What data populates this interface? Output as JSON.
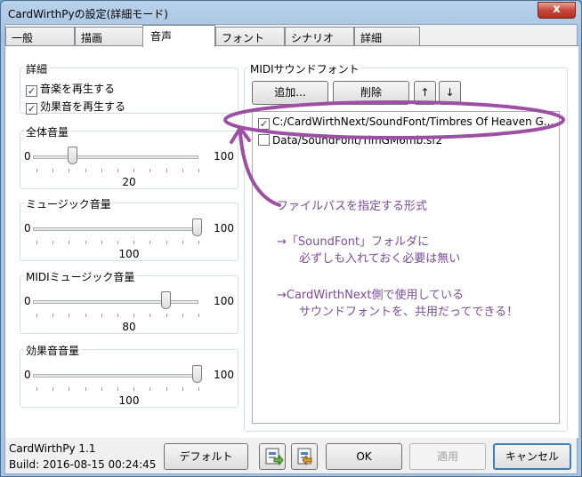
{
  "window": {
    "title": "CardWirthPyの設定(詳細モード)",
    "close_glyph": "x"
  },
  "tabs": [
    "一般",
    "描画",
    "音声",
    "フォント",
    "シナリオ",
    "詳細"
  ],
  "active_tab": "音声",
  "details": {
    "title": "詳細",
    "play_music": {
      "label": "音楽を再生する",
      "checked": true
    },
    "play_sfx": {
      "label": "効果音を再生する",
      "checked": true
    }
  },
  "volumes": [
    {
      "title": "全体音量",
      "min": "0",
      "max": "100",
      "value": 20
    },
    {
      "title": "ミュージック音量",
      "min": "0",
      "max": "100",
      "value": 100
    },
    {
      "title": "MIDIミュージック音量",
      "min": "0",
      "max": "100",
      "value": 80
    },
    {
      "title": "効果音音量",
      "min": "0",
      "max": "100",
      "value": 100
    }
  ],
  "midi": {
    "title": "MIDIサウンドフォント",
    "add_label": "追加...",
    "delete_label": "削除",
    "up_glyph": "↑",
    "down_glyph": "↓",
    "items": [
      {
        "path": "C:/CardWirthNext/SoundFont/Timbres Of Heaven G...",
        "checked": true
      },
      {
        "path": "Data/SoundFont/TimGM6mb.sf2",
        "checked": false
      }
    ]
  },
  "annotation": {
    "color": "#7c4d9a",
    "line1": "ファイルパスを指定する形式",
    "line2": "→「SoundFont」フォルダに",
    "line3": "必ずしも入れておく必要は無い",
    "line4": "→CardWirthNext側で使用している",
    "line5": "サウンドフォントを、共用だってできる！"
  },
  "footer": {
    "version": "CardWirthPy 1.1",
    "build": "Build:  2016-08-15 00:24:45",
    "default_label": "デフォルト",
    "ok_label": "OK",
    "apply_label": "適用",
    "cancel_label": "キャンセル"
  }
}
